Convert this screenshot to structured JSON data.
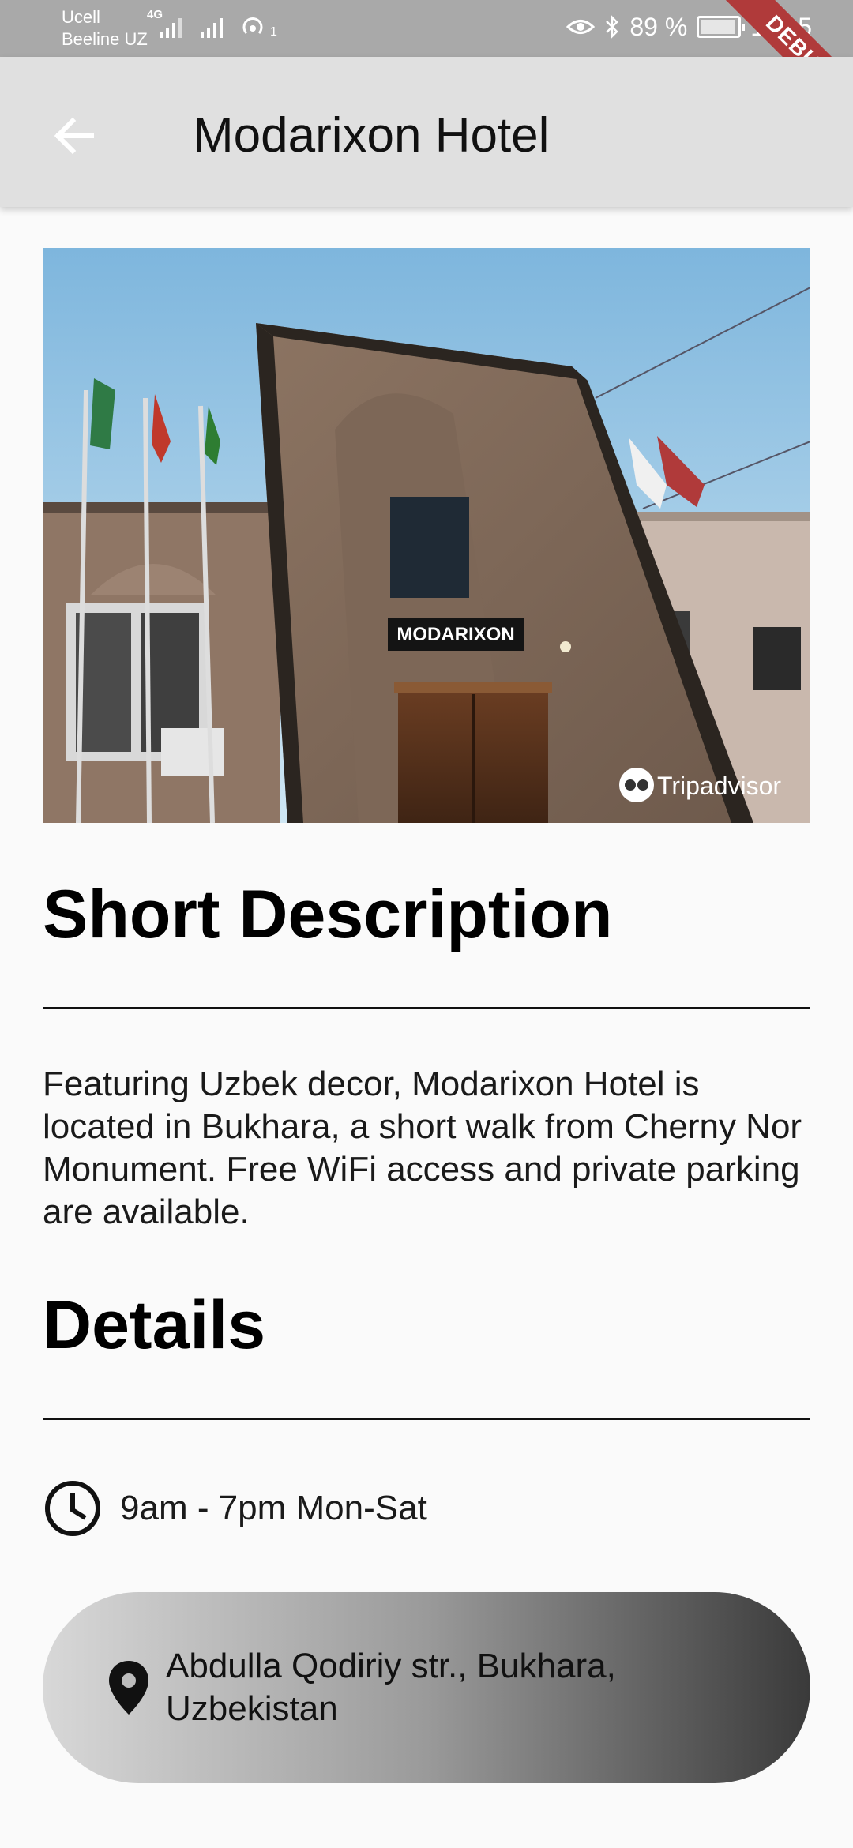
{
  "status_bar": {
    "carrier_1": "Ucell",
    "carrier_2": "Beeline UZ",
    "network_label": "4G",
    "hotspot_count": "1",
    "battery": "89 %",
    "time": "11:15"
  },
  "debug_banner": "DEBUG",
  "app_bar": {
    "title": "Modarixon Hotel",
    "back_icon": "arrow-back-icon"
  },
  "hero_image": {
    "sign_text": "MODARIXON",
    "watermark": "Tripadvisor"
  },
  "short_description": {
    "heading": "Short Description",
    "body": "Featuring Uzbek decor, Modarixon Hotel is located in Bukhara, a short walk from Cherny Nor Monument. Free WiFi access and private parking are available."
  },
  "details": {
    "heading": "Details",
    "hours": "9am - 7pm Mon-Sat",
    "hours_icon": "clock-icon",
    "address": "Abdulla Qodiriy str., Bukhara, Uzbekistan",
    "address_icon": "location-pin-icon"
  },
  "colors": {
    "app_bar_bg": "#e0e0e0",
    "status_bar_bg": "#a9a9a9",
    "page_bg": "#fafafa",
    "debug_ribbon": "#b03a3a"
  }
}
